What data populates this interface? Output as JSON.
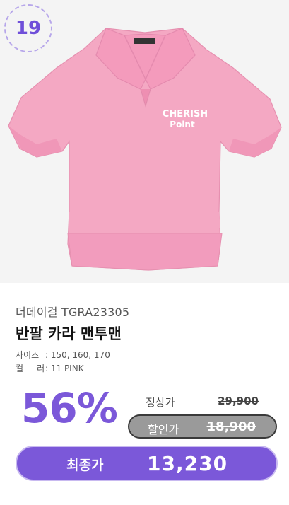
{
  "rank": "19",
  "product": {
    "image_alt_icon": "polo-shirt-image",
    "logo_text_line1": "CHERISH",
    "logo_text_line2": "Point",
    "brand": "더데이걸 TGRA23305",
    "name": "반팔 카라 맨투맨",
    "specs": {
      "size_label": "사이즈",
      "size_value": ": 150, 160, 170",
      "color_label": "컬     러",
      "color_value": ": 11 PINK"
    },
    "colors": {
      "shirt": "#f4a8c3",
      "accent": "#7b58d9"
    }
  },
  "pricing": {
    "discount_rate": "56%",
    "regular_label": "정상가",
    "regular_price": "29,900",
    "sale_label": "할인가",
    "sale_price": "18,900",
    "final_label": "최종가",
    "final_price": "13,230"
  }
}
